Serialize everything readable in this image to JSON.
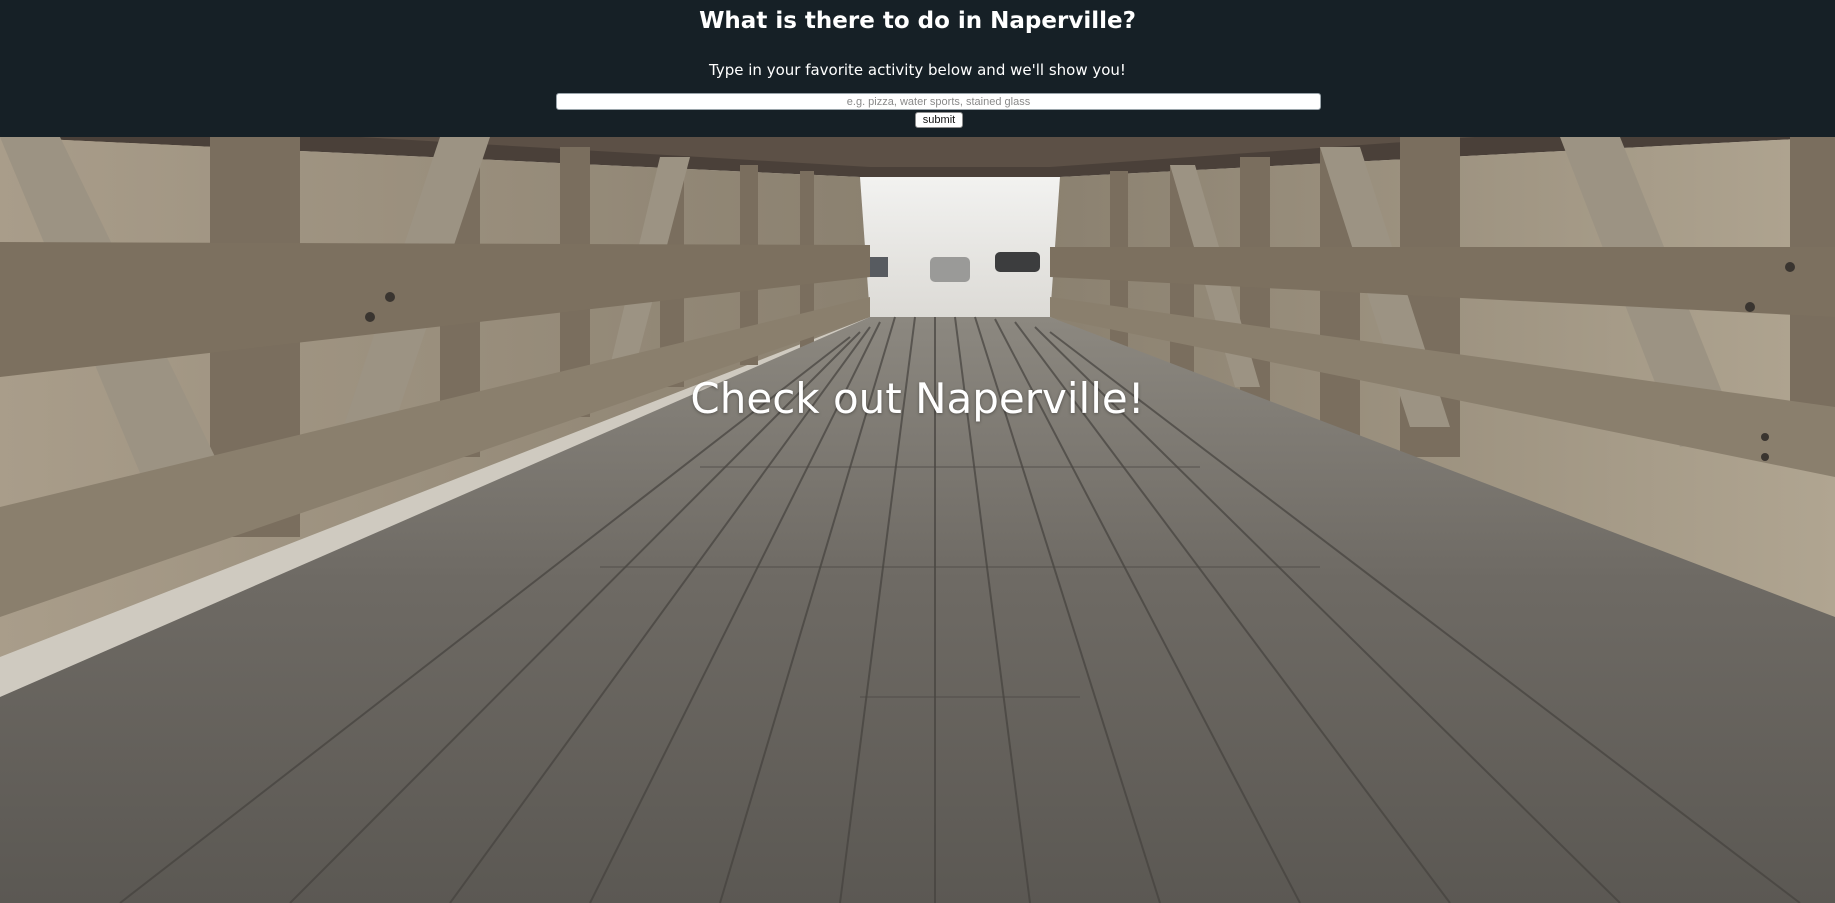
{
  "header": {
    "title": "What is there to do in Naperville?",
    "subtitle": "Type in your favorite activity below and we'll show you!"
  },
  "search": {
    "placeholder": "e.g. pizza, water sports, stained glass",
    "value": "",
    "submit_label": "submit"
  },
  "hero": {
    "title": "Check out Naperville!",
    "image": "covered-bridge-photo"
  },
  "colors": {
    "header_bg": "#162026",
    "text": "#ffffff"
  }
}
